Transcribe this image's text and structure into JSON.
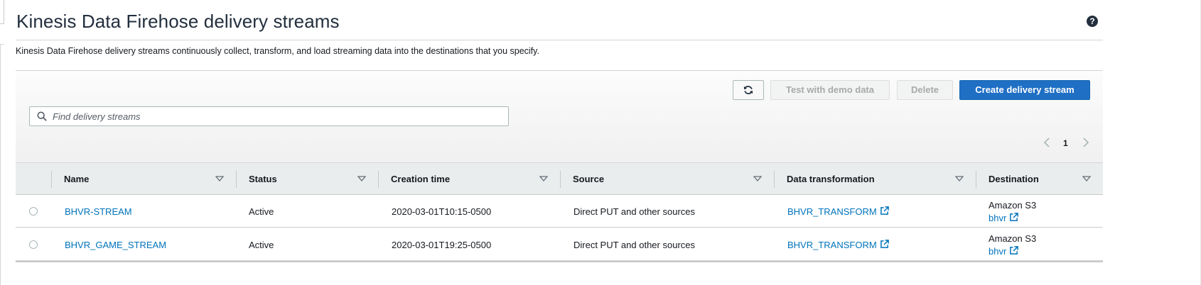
{
  "header": {
    "title": "Kinesis Data Firehose delivery streams",
    "help_icon": "question-circle-icon",
    "description": "Kinesis Data Firehose delivery streams continuously collect, transform, and load streaming data into the destinations that you specify."
  },
  "toolbar": {
    "refresh_icon": "refresh-icon",
    "test_label": "Test with demo data",
    "delete_label": "Delete",
    "create_label": "Create delivery stream"
  },
  "search": {
    "placeholder": "Find delivery streams",
    "value": ""
  },
  "pagination": {
    "current_page": "1"
  },
  "table": {
    "columns": [
      "Name",
      "Status",
      "Creation time",
      "Source",
      "Data transformation",
      "Destination"
    ],
    "rows": [
      {
        "name": "BHVR-STREAM",
        "status": "Active",
        "creation_time": "2020-03-01T10:15-0500",
        "source": "Direct PUT and other sources",
        "transformation": "BHVR_TRANSFORM",
        "destination_type": "Amazon S3",
        "destination_name": "bhvr"
      },
      {
        "name": "BHVR_GAME_STREAM",
        "status": "Active",
        "creation_time": "2020-03-01T19:25-0500",
        "source": "Direct PUT and other sources",
        "transformation": "BHVR_TRANSFORM",
        "destination_type": "Amazon S3",
        "destination_name": "bhvr"
      }
    ]
  },
  "colors": {
    "primary_button": "#1f6fc5",
    "link": "#0073bb",
    "header_bg": "#eaeded"
  }
}
